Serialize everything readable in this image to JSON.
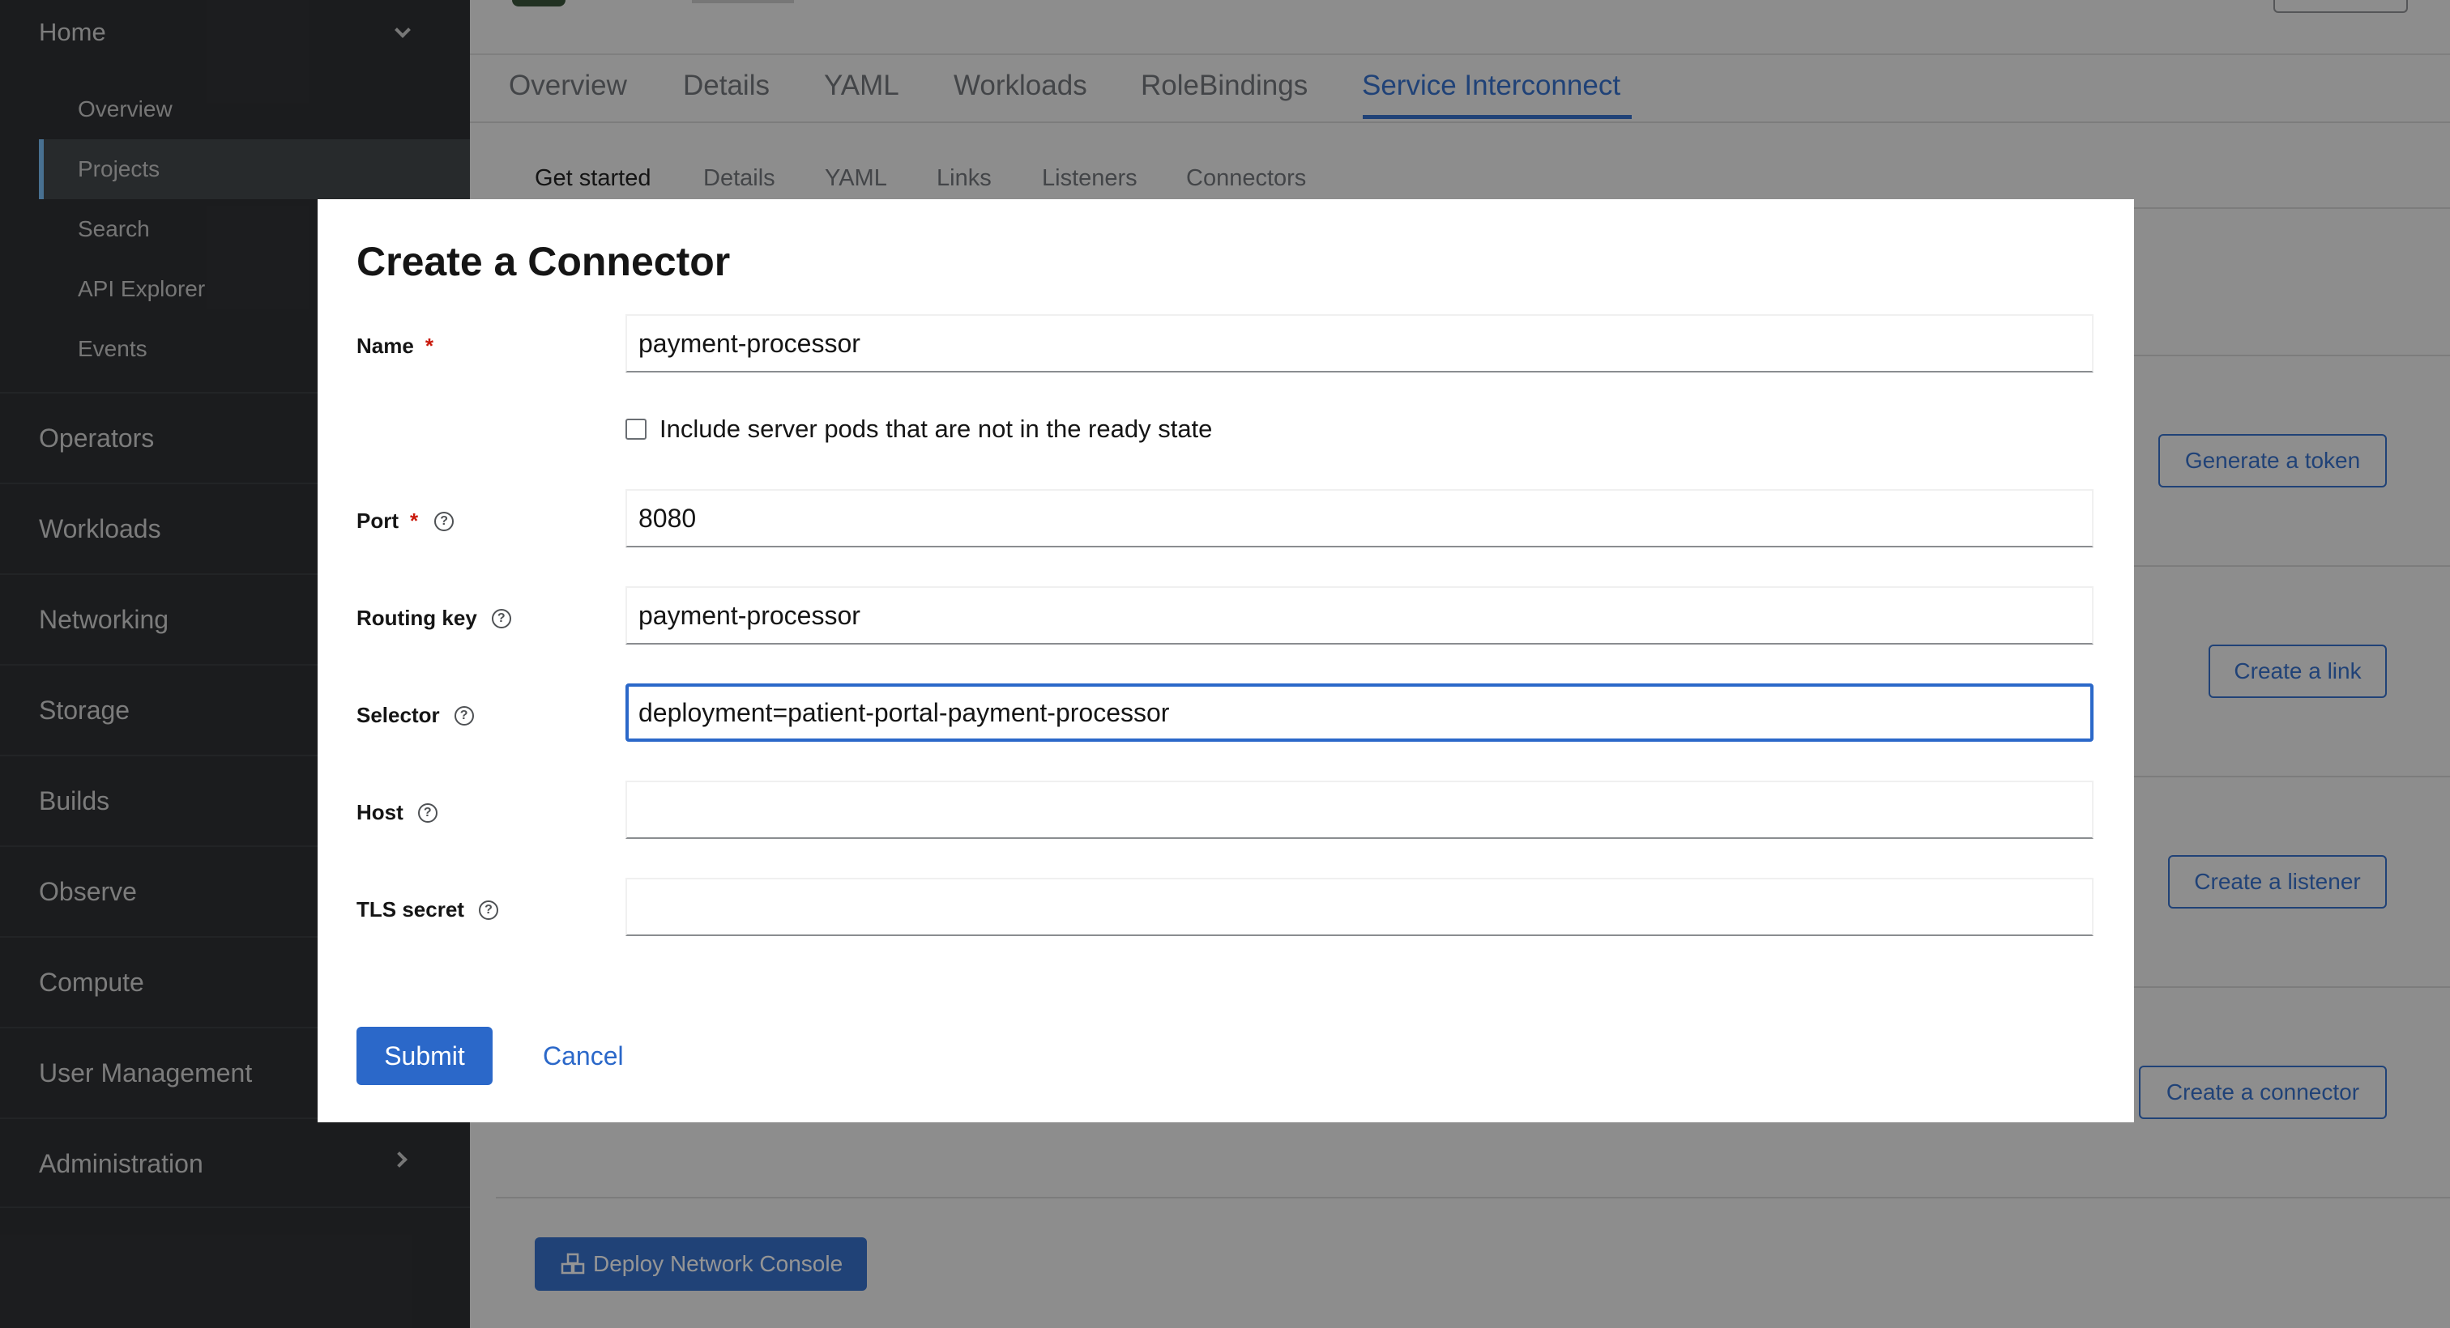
{
  "sidebar": {
    "home_label": "Home",
    "home_items": [
      "Overview",
      "Projects",
      "Search",
      "API Explorer",
      "Events"
    ],
    "active_item": "Projects",
    "groups": [
      "Operators",
      "Workloads",
      "Networking",
      "Storage",
      "Builds",
      "Observe",
      "Compute",
      "User Management",
      "Administration"
    ]
  },
  "tabs": {
    "primary": [
      "Overview",
      "Details",
      "YAML",
      "Workloads",
      "RoleBindings",
      "Service Interconnect"
    ],
    "primary_active": "Service Interconnect",
    "secondary": [
      "Get started",
      "Details",
      "YAML",
      "Links",
      "Listeners",
      "Connectors"
    ],
    "secondary_active": "Get started"
  },
  "background_actions": {
    "generate_token": "Generate a token",
    "create_link": "Create a link",
    "create_listener": "Create a listener",
    "create_connector": "Create a connector",
    "deploy_console": "Deploy Network Console"
  },
  "modal": {
    "title": "Create a Connector",
    "fields": {
      "name": {
        "label": "Name",
        "value": "payment-processor",
        "required": true
      },
      "include_not_ready": {
        "label": "Include server pods that are not in the ready state",
        "checked": false
      },
      "port": {
        "label": "Port",
        "value": "8080",
        "required": true
      },
      "routing_key": {
        "label": "Routing key",
        "value": "payment-processor"
      },
      "selector": {
        "label": "Selector",
        "value": "deployment=patient-portal-payment-processor"
      },
      "host": {
        "label": "Host",
        "value": ""
      },
      "tls_secret": {
        "label": "TLS secret",
        "value": ""
      }
    },
    "required_marker": "*",
    "help_glyph": "?",
    "submit_label": "Submit",
    "cancel_label": "Cancel"
  },
  "colors": {
    "primary_blue": "#2b68c9",
    "sidebar_bg": "#212427",
    "required_red": "#c9190b",
    "active_accent": "#73bcf7"
  }
}
